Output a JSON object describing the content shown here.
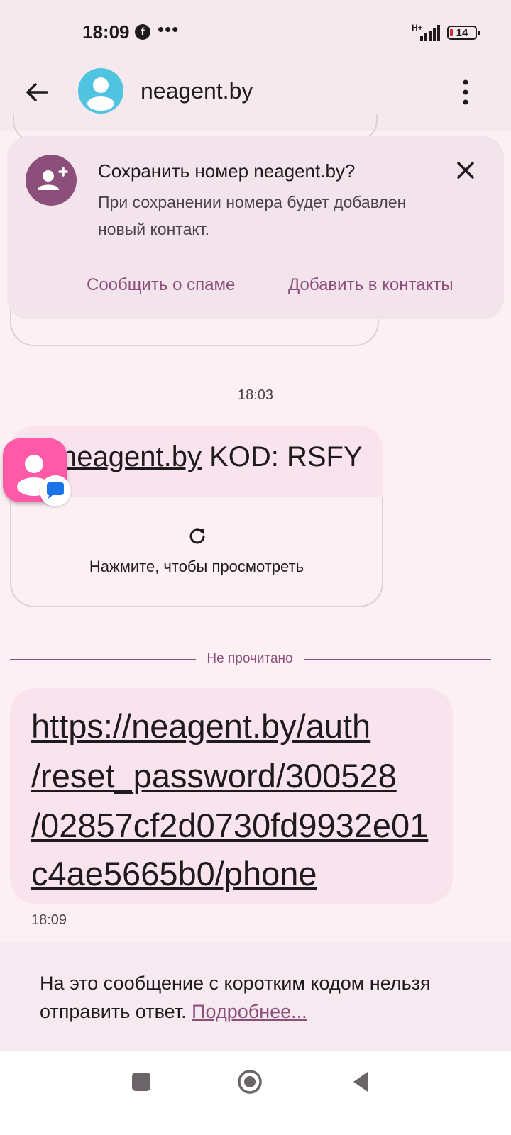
{
  "status_bar": {
    "time": "18:09",
    "notification_icon": "facebook-icon",
    "more_notifications": "•••",
    "network_type": "H+",
    "battery_level": "14"
  },
  "app_bar": {
    "contact_name": "neagent.by"
  },
  "save_banner": {
    "title": "Сохранить номер neagent.by?",
    "text": "При сохранении номера будет добавлен новый контакт.",
    "report_spam_label": "Сообщить о спаме",
    "add_contact_label": "Добавить в контакты"
  },
  "conversation": {
    "timestamp_1": "18:03",
    "code_message": {
      "link_part": "neagent.by",
      "code_part": " KOD: RSFY"
    },
    "preview_prompt": "Нажмите, чтобы просмотреть",
    "unread_divider": "Не прочитано",
    "link_message_lines": [
      "https://neagent.by/auth",
      "/reset_password/300528",
      "/02857cf2d0730fd9932e01",
      "c4ae5665b0/phone"
    ],
    "link_message_time": "18:09"
  },
  "footer": {
    "notice_text": "На это сообщение с коротким кодом нельзя отправить ответ. ",
    "learn_more_label": "Подробнее..."
  },
  "colors": {
    "background": "#fcf0f5",
    "accent": "#8c4f7c",
    "bubble": "#f9e4ee",
    "avatar": "#4fc3e0",
    "chat_head": "#ff5aa8",
    "battery_low": "#d32f2f"
  }
}
